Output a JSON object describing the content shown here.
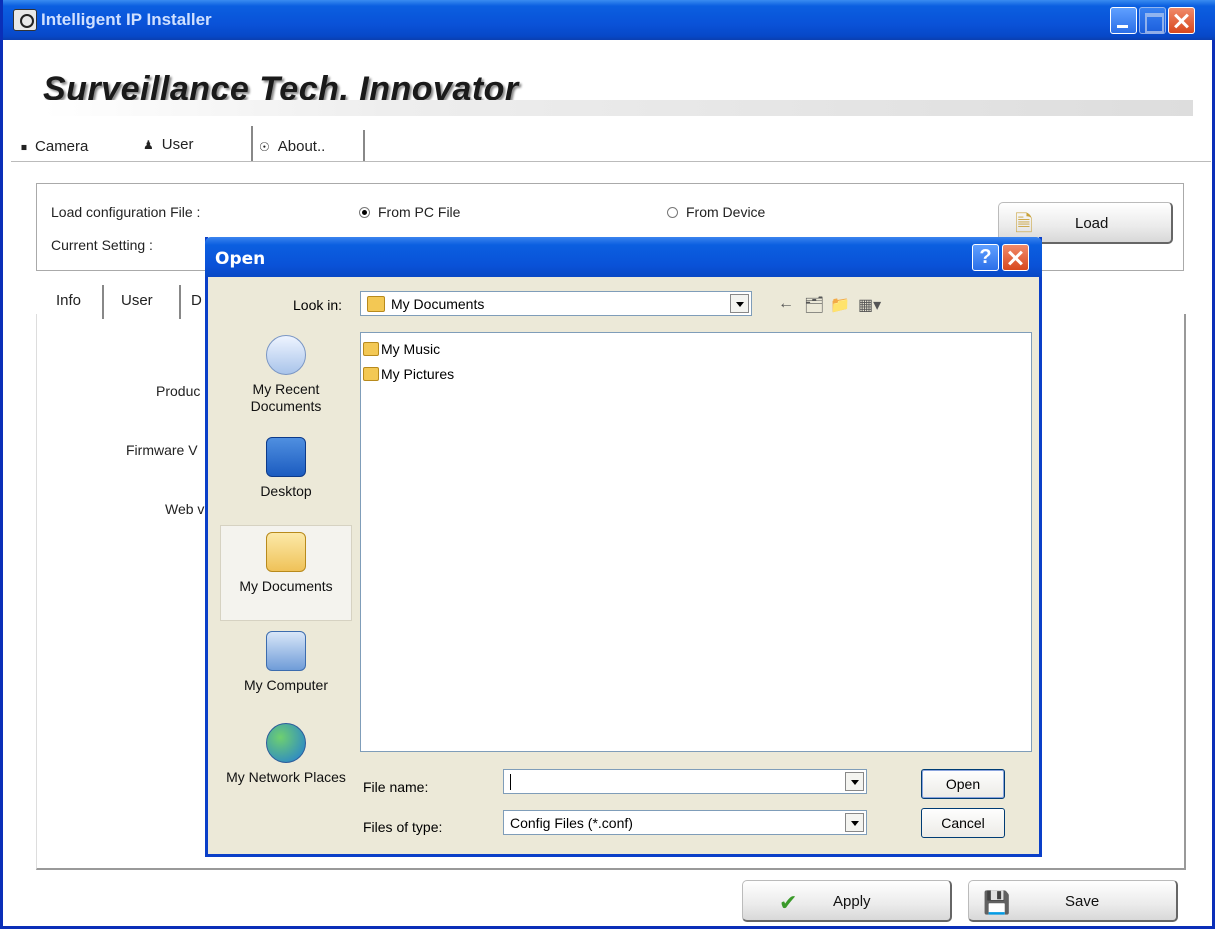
{
  "app": {
    "title": "Intelligent IP Installer"
  },
  "banner": "Surveillance Tech. Innovator",
  "tabs": [
    {
      "label": "Camera"
    },
    {
      "label": "User"
    },
    {
      "label": "About.."
    }
  ],
  "config": {
    "load_label": "Load configuration File :",
    "current_label": "Current Setting :",
    "from_pc": "From PC File",
    "from_device": "From Device",
    "load_button": "Load"
  },
  "inner_tabs": [
    {
      "label": "Info"
    },
    {
      "label": "User"
    },
    {
      "label": "D"
    }
  ],
  "info_labels": {
    "product": "Produc",
    "firmware": "Firmware V",
    "web": "Web v"
  },
  "dialog": {
    "title": "Open",
    "help": "?",
    "look_in_label": "Look in:",
    "look_in_value": "My Documents",
    "places": [
      {
        "label": "My Recent Documents"
      },
      {
        "label": "Desktop"
      },
      {
        "label": "My Documents"
      },
      {
        "label": "My Computer"
      },
      {
        "label": "My Network Places"
      }
    ],
    "files": [
      {
        "name": "My Music"
      },
      {
        "name": "My Pictures"
      }
    ],
    "file_name_label": "File name:",
    "file_name_value": "",
    "file_type_label": "Files of type:",
    "file_type_value": "Config Files (*.conf)",
    "open_button": "Open",
    "cancel_button": "Cancel"
  },
  "footer": {
    "apply": "Apply",
    "save": "Save"
  },
  "colors": {
    "titlebar": "#0a52d8",
    "dialog_bg": "#ece9d8",
    "close": "#d8481e"
  }
}
